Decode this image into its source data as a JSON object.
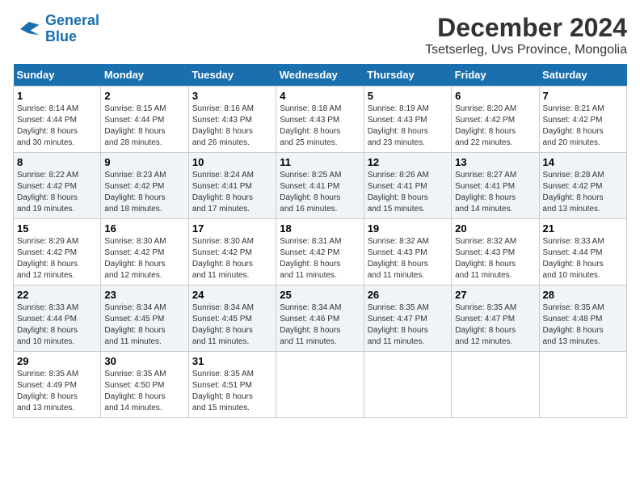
{
  "logo": {
    "line1": "General",
    "line2": "Blue"
  },
  "title": "December 2024",
  "subtitle": "Tsetserleg, Uvs Province, Mongolia",
  "days_of_week": [
    "Sunday",
    "Monday",
    "Tuesday",
    "Wednesday",
    "Thursday",
    "Friday",
    "Saturday"
  ],
  "weeks": [
    [
      {
        "day": 1,
        "info": "Sunrise: 8:14 AM\nSunset: 4:44 PM\nDaylight: 8 hours\nand 30 minutes."
      },
      {
        "day": 2,
        "info": "Sunrise: 8:15 AM\nSunset: 4:44 PM\nDaylight: 8 hours\nand 28 minutes."
      },
      {
        "day": 3,
        "info": "Sunrise: 8:16 AM\nSunset: 4:43 PM\nDaylight: 8 hours\nand 26 minutes."
      },
      {
        "day": 4,
        "info": "Sunrise: 8:18 AM\nSunset: 4:43 PM\nDaylight: 8 hours\nand 25 minutes."
      },
      {
        "day": 5,
        "info": "Sunrise: 8:19 AM\nSunset: 4:43 PM\nDaylight: 8 hours\nand 23 minutes."
      },
      {
        "day": 6,
        "info": "Sunrise: 8:20 AM\nSunset: 4:42 PM\nDaylight: 8 hours\nand 22 minutes."
      },
      {
        "day": 7,
        "info": "Sunrise: 8:21 AM\nSunset: 4:42 PM\nDaylight: 8 hours\nand 20 minutes."
      }
    ],
    [
      {
        "day": 8,
        "info": "Sunrise: 8:22 AM\nSunset: 4:42 PM\nDaylight: 8 hours\nand 19 minutes."
      },
      {
        "day": 9,
        "info": "Sunrise: 8:23 AM\nSunset: 4:42 PM\nDaylight: 8 hours\nand 18 minutes."
      },
      {
        "day": 10,
        "info": "Sunrise: 8:24 AM\nSunset: 4:41 PM\nDaylight: 8 hours\nand 17 minutes."
      },
      {
        "day": 11,
        "info": "Sunrise: 8:25 AM\nSunset: 4:41 PM\nDaylight: 8 hours\nand 16 minutes."
      },
      {
        "day": 12,
        "info": "Sunrise: 8:26 AM\nSunset: 4:41 PM\nDaylight: 8 hours\nand 15 minutes."
      },
      {
        "day": 13,
        "info": "Sunrise: 8:27 AM\nSunset: 4:41 PM\nDaylight: 8 hours\nand 14 minutes."
      },
      {
        "day": 14,
        "info": "Sunrise: 8:28 AM\nSunset: 4:42 PM\nDaylight: 8 hours\nand 13 minutes."
      }
    ],
    [
      {
        "day": 15,
        "info": "Sunrise: 8:29 AM\nSunset: 4:42 PM\nDaylight: 8 hours\nand 12 minutes."
      },
      {
        "day": 16,
        "info": "Sunrise: 8:30 AM\nSunset: 4:42 PM\nDaylight: 8 hours\nand 12 minutes."
      },
      {
        "day": 17,
        "info": "Sunrise: 8:30 AM\nSunset: 4:42 PM\nDaylight: 8 hours\nand 11 minutes."
      },
      {
        "day": 18,
        "info": "Sunrise: 8:31 AM\nSunset: 4:42 PM\nDaylight: 8 hours\nand 11 minutes."
      },
      {
        "day": 19,
        "info": "Sunrise: 8:32 AM\nSunset: 4:43 PM\nDaylight: 8 hours\nand 11 minutes."
      },
      {
        "day": 20,
        "info": "Sunrise: 8:32 AM\nSunset: 4:43 PM\nDaylight: 8 hours\nand 11 minutes."
      },
      {
        "day": 21,
        "info": "Sunrise: 8:33 AM\nSunset: 4:44 PM\nDaylight: 8 hours\nand 10 minutes."
      }
    ],
    [
      {
        "day": 22,
        "info": "Sunrise: 8:33 AM\nSunset: 4:44 PM\nDaylight: 8 hours\nand 10 minutes."
      },
      {
        "day": 23,
        "info": "Sunrise: 8:34 AM\nSunset: 4:45 PM\nDaylight: 8 hours\nand 11 minutes."
      },
      {
        "day": 24,
        "info": "Sunrise: 8:34 AM\nSunset: 4:45 PM\nDaylight: 8 hours\nand 11 minutes."
      },
      {
        "day": 25,
        "info": "Sunrise: 8:34 AM\nSunset: 4:46 PM\nDaylight: 8 hours\nand 11 minutes."
      },
      {
        "day": 26,
        "info": "Sunrise: 8:35 AM\nSunset: 4:47 PM\nDaylight: 8 hours\nand 11 minutes."
      },
      {
        "day": 27,
        "info": "Sunrise: 8:35 AM\nSunset: 4:47 PM\nDaylight: 8 hours\nand 12 minutes."
      },
      {
        "day": 28,
        "info": "Sunrise: 8:35 AM\nSunset: 4:48 PM\nDaylight: 8 hours\nand 13 minutes."
      }
    ],
    [
      {
        "day": 29,
        "info": "Sunrise: 8:35 AM\nSunset: 4:49 PM\nDaylight: 8 hours\nand 13 minutes."
      },
      {
        "day": 30,
        "info": "Sunrise: 8:35 AM\nSunset: 4:50 PM\nDaylight: 8 hours\nand 14 minutes."
      },
      {
        "day": 31,
        "info": "Sunrise: 8:35 AM\nSunset: 4:51 PM\nDaylight: 8 hours\nand 15 minutes."
      },
      {
        "day": null,
        "info": ""
      },
      {
        "day": null,
        "info": ""
      },
      {
        "day": null,
        "info": ""
      },
      {
        "day": null,
        "info": ""
      }
    ]
  ]
}
